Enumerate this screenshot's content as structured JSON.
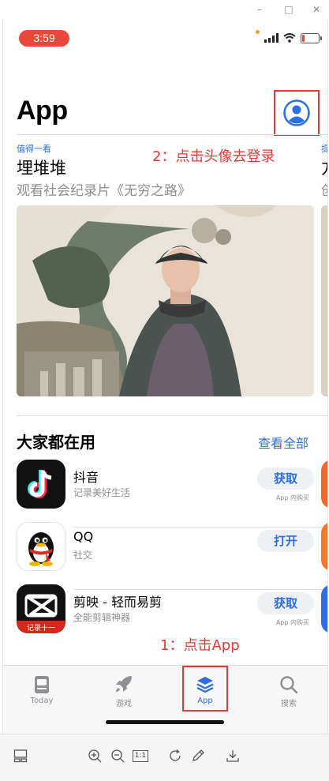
{
  "window": {
    "minimize_glyph": "–",
    "maximize_glyph": "□",
    "close_glyph": "✕"
  },
  "status_bar": {
    "time": "3:59",
    "icons": [
      "dot-icon",
      "signal-icon",
      "wifi-icon",
      "battery-low-icon"
    ]
  },
  "header": {
    "title": "App",
    "account_icon": "person-circle-icon"
  },
  "annotations": {
    "step2": "2：点击头像去登录",
    "step1": "1：点击App"
  },
  "featured": {
    "tag": "值得一看",
    "title": "埋堆堆",
    "subtitle": "观看社会纪录片《无穷之路》",
    "peek_tag": "提",
    "peek_title": "方",
    "peek_subtitle": "创"
  },
  "section": {
    "title": "大家都在用",
    "see_all": "查看全部",
    "apps": [
      {
        "name": "抖音",
        "desc": "记录美好生活",
        "button": "获取",
        "iap": "App 内购买",
        "icon": "douyin-icon"
      },
      {
        "name": "QQ",
        "desc": "社交",
        "button": "打开",
        "iap": "",
        "icon": "qq-penguin-icon"
      },
      {
        "name": "剪映 - 轻而易剪",
        "desc": "全能剪辑神器",
        "button": "获取",
        "iap": "App 内购买",
        "icon": "capcut-icon",
        "icon_text": "记录十一"
      }
    ]
  },
  "tabbar": {
    "tabs": [
      {
        "label": "Today",
        "icon": "today-icon"
      },
      {
        "label": "游戏",
        "icon": "rocket-icon"
      },
      {
        "label": "App",
        "icon": "layers-icon",
        "active": true
      },
      {
        "label": "搜索",
        "icon": "search-icon"
      }
    ]
  },
  "toolbar": {
    "buttons": [
      "layout-icon",
      "zoom-in-icon",
      "zoom-out-icon",
      "actual-size-icon",
      "rotate-icon",
      "edit-pencil-icon",
      "download-icon"
    ],
    "actual_size_label": "1:1"
  },
  "colors": {
    "accent": "#2b6fe0",
    "annotation": "#e53935",
    "time_pill": "#e8493a"
  }
}
